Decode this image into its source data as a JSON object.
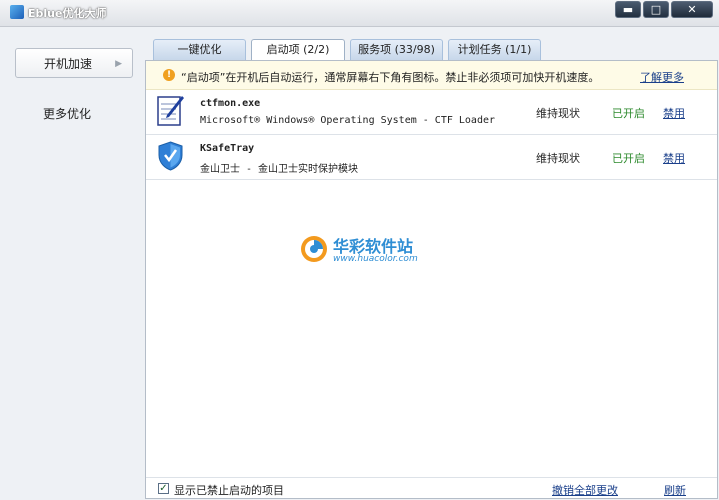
{
  "window": {
    "title": "Eblue优化大师",
    "buttons": [
      "minimize-icon",
      "maximize-icon",
      "close-icon"
    ]
  },
  "sidebar": {
    "items": [
      {
        "label": "开机加速",
        "active": true
      },
      {
        "label": "更多优化",
        "active": false
      }
    ]
  },
  "tabs": [
    {
      "label": "一键优化",
      "active": false
    },
    {
      "label": "启动项 (2/2)",
      "active": true
    },
    {
      "label": "服务项 (33/98)",
      "active": false
    },
    {
      "label": "计划任务 (1/1)",
      "active": false
    }
  ],
  "notice": {
    "icon": "warning-icon",
    "text": "“启动项”在开机后自动运行，通常屏幕右下角有图标。禁止非必须项可加快开机速度。",
    "link": "了解更多"
  },
  "startup_items": [
    {
      "icon": "notepad-pen-icon",
      "name": "ctfmon.exe",
      "description": "Microsoft® Windows® Operating System - CTF Loader",
      "recommendation": "维持现状",
      "status": "已开启",
      "action": "禁用"
    },
    {
      "icon": "shield-check-icon",
      "name": "KSafeTray",
      "description": "金山卫士 - 金山卫士实时保护模块",
      "recommendation": "维持现状",
      "status": "已开启",
      "action": "禁用"
    }
  ],
  "watermark": {
    "icon": "huacolor-logo-icon",
    "title": "华彩软件站",
    "url": "www.huacolor.com"
  },
  "footer": {
    "show_disabled_checked": true,
    "show_disabled_label": "显示已禁止启动的项目",
    "undo_all": "撤销全部更改",
    "refresh": "刷新"
  },
  "colors": {
    "link": "#1a3f8a",
    "status_on": "#2d8a2d",
    "notice_bg": "#fefbe7"
  }
}
